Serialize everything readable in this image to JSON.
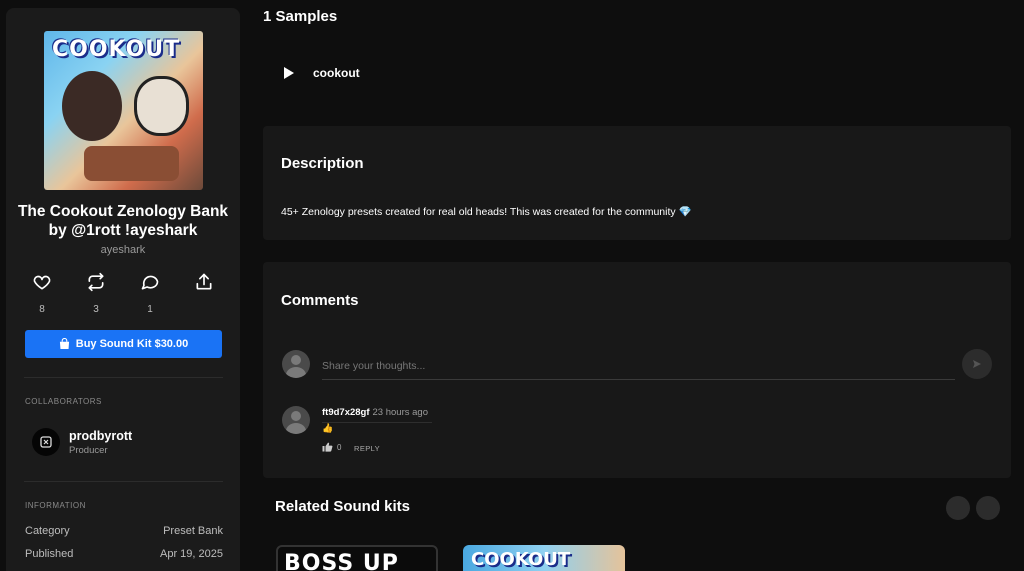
{
  "sidebar": {
    "cover_art_text": "COOKOUT",
    "title": "The Cookout Zenology Bank by @1rott !ayeshark",
    "author": "ayeshark",
    "actions": [
      {
        "name": "like",
        "count": "8"
      },
      {
        "name": "repost",
        "count": "3"
      },
      {
        "name": "comment",
        "count": "1"
      },
      {
        "name": "share",
        "count": ""
      }
    ],
    "buy_label": "Buy Sound Kit $30.00",
    "collaborators_label": "COLLABORATORS",
    "collaborator": {
      "name": "prodbyrott",
      "role": "Producer"
    },
    "information_label": "INFORMATION",
    "info": [
      {
        "key": "Category",
        "value": "Preset Bank"
      },
      {
        "key": "Published",
        "value": "Apr 19, 2025"
      }
    ]
  },
  "samples": {
    "title": "1 Samples",
    "items": [
      {
        "name": "cookout"
      }
    ]
  },
  "description": {
    "title": "Description",
    "text": "45+ Zenology presets created for real old heads! This was created for the community",
    "emoji": "💎"
  },
  "comments": {
    "title": "Comments",
    "input_placeholder": "Share your thoughts...",
    "items": [
      {
        "user": "ft9d7x28gf",
        "time": "23 hours ago",
        "body": "👍",
        "likes": "0",
        "reply_label": "REPLY"
      }
    ]
  },
  "related": {
    "title": "Related Sound kits",
    "thumbs": [
      "BOSS UP",
      "COOKOUT"
    ]
  },
  "colors": {
    "accent": "#1a73f5",
    "background": "#0e0e0e",
    "panel": "#1b1b1b",
    "card": "#181818"
  }
}
